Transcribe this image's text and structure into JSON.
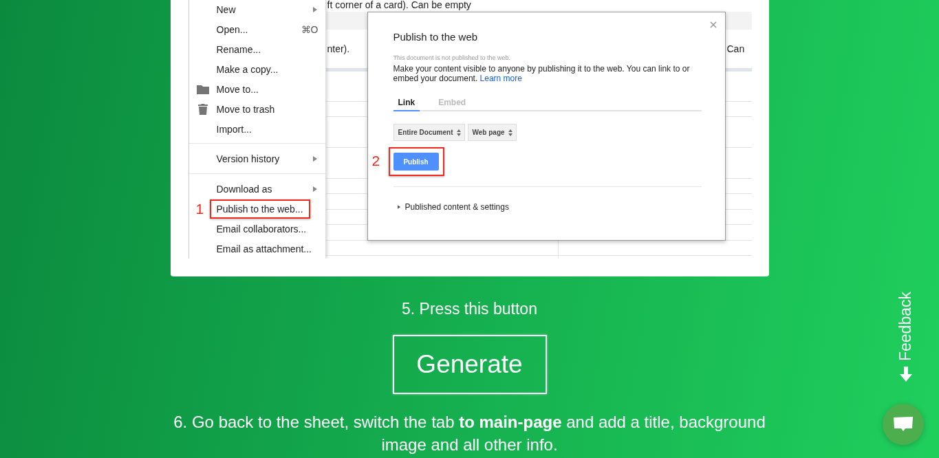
{
  "tutorial_image": {
    "sheet_texts": [
      "ft corner of a card). Can be empty",
      "nter).",
      "Can"
    ],
    "file_menu": {
      "sections": [
        [
          {
            "kind": "plain",
            "label": "New",
            "submenu": true,
            "selected": false
          },
          {
            "kind": "plain",
            "label": "Open...",
            "shortcut": "⌘O",
            "submenu": false,
            "selected": false
          },
          {
            "kind": "plain",
            "label": "Rename...",
            "submenu": false,
            "selected": false
          },
          {
            "kind": "plain",
            "label": "Make a copy...",
            "submenu": false,
            "selected": false
          },
          {
            "kind": "folder",
            "label": "Move to...",
            "submenu": false,
            "selected": false
          },
          {
            "kind": "trash",
            "label": "Move to trash",
            "submenu": false,
            "selected": false
          },
          {
            "kind": "plain",
            "label": "Import...",
            "submenu": false,
            "selected": false
          }
        ],
        [
          {
            "kind": "plain",
            "label": "Version history",
            "submenu": true,
            "selected": false
          }
        ],
        [
          {
            "kind": "plain",
            "label": "Download as",
            "submenu": true,
            "selected": false
          },
          {
            "kind": "plain",
            "label": "Publish to the web...",
            "submenu": false,
            "selected": true,
            "marker": "1"
          },
          {
            "kind": "plain",
            "label": "Email collaborators...",
            "submenu": false,
            "selected": false
          },
          {
            "kind": "plain",
            "label": "Email as attachment...",
            "submenu": false,
            "selected": false
          }
        ]
      ]
    },
    "dialog": {
      "title": "Publish to the web",
      "status": "This document is not published to the web.",
      "description": "Make your content visible to anyone by publishing it to the web. You can link to or embed your document.",
      "link": "Learn more",
      "tabs": [
        {
          "label": "Link",
          "selected": true
        },
        {
          "label": "Embed",
          "selected": false
        }
      ],
      "selects": [
        "Entire Document",
        "Web page"
      ],
      "publish_button": {
        "label": "Publish",
        "marker": "2"
      },
      "section": {
        "label": "Published content & settings",
        "expanded": false
      }
    }
  },
  "step_5": "5. Press this button",
  "generate_button": "Generate",
  "step_6": "6. Go back to the sheet, switch the tab **to main-page** and add a title, background image and all other info.",
  "feedback_tab": "Feedback"
}
